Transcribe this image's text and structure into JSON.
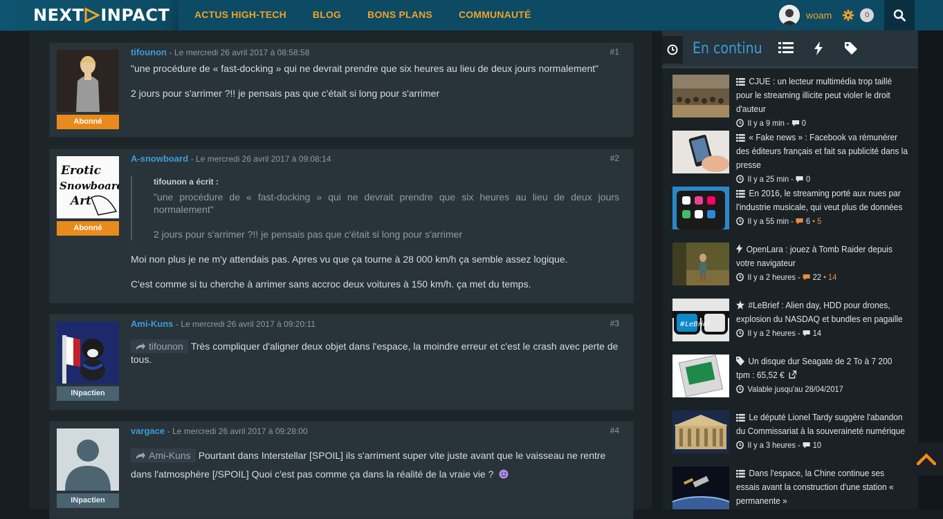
{
  "header": {
    "logo_text_left": "NEXT",
    "logo_text_right": "INPACT",
    "nav": [
      "ACTUS HIGH-TECH",
      "BLOG",
      "BONS PLANS",
      "COMMUNAUTÉ"
    ],
    "username": "woam",
    "notif_count": "0"
  },
  "comments": [
    {
      "author": "tifounon",
      "date": "- Le mercredi 26 avril 2017 à 08:58:58",
      "num": "#1",
      "badge": "Abonné",
      "paragraphs": [
        "\"une procédure de « fast-docking » qui ne devrait prendre que six heures au lieu de deux jours normalement\"",
        "2 jours pour s'arrimer ?!! je pensais pas que c'était si long pour s'arrimer"
      ]
    },
    {
      "author": "A-snowboard",
      "date": "- Le mercredi 26 avril 2017 à 09:08:14",
      "num": "#2",
      "badge": "Abonné",
      "quote_author": "tifounon a écrit :",
      "quote": [
        "\"une procédure de « fast-docking » qui ne devrait prendre que six heures au lieu de deux jours normalement\"",
        "2 jours pour s'arrimer ?!! je pensais pas que c'était si long pour s'arrimer"
      ],
      "paragraphs": [
        "Moi non plus je ne m'y attendais pas. Apres vu que ça tourne à 28 000 km/h ça semble assez logique.",
        "C'est comme si tu cherche à arrimer sans accroc deux voitures à 150 km/h. ça met du temps."
      ]
    },
    {
      "author": "Ami-Kuns",
      "date": "- Le mercredi 26 avril 2017 à 09:20:11",
      "num": "#3",
      "badge": "INpactien",
      "reply_to": "tifounon",
      "text": "Très compliquer d'aligner deux objet dans l'espace, la moindre erreur et c'est le crash avec perte de tous."
    },
    {
      "author": "vargace",
      "date": "- Le mercredi 26 avril 2017 à 09:28:00",
      "num": "#4",
      "badge": "INpactien",
      "reply_to": "Ami-Kuns",
      "text": "Pourtant dans Interstellar  [SPOIL] ils s'arriment super vite juste avant que le vaisseau ne rentre dans l'atmosphère [/SPOIL] Quoi c'est pas comme ça dans la réalité de la vraie vie ?"
    }
  ],
  "sidebar": {
    "title": "En continu",
    "news": [
      {
        "icon": "list-icon",
        "title": "CJUE : un lecteur multimédia trop taillé pour le streaming illicite peut violer le droit d'auteur",
        "time": "Il y a 9 min",
        "comments": "0",
        "hot": ""
      },
      {
        "icon": "list-icon",
        "title": "« Fake news » : Facebook va rémunérer des éditeurs français et fait sa publicité dans la presse",
        "time": "Il y a 25 min",
        "comments": "0",
        "hot": ""
      },
      {
        "icon": "list-icon",
        "title": "En 2016, le streaming porté aux nues par l'industrie musicale, qui veut plus de données",
        "time": "Il y a 55 min",
        "comments": "6",
        "hot": "• 5"
      },
      {
        "icon": "bolt-icon",
        "title": "OpenLara : jouez à Tomb Raider depuis votre navigateur",
        "time": "Il y a 2 heures",
        "comments": "22",
        "hot": "• 14"
      },
      {
        "icon": "star-icon",
        "title": "#LeBrief : Alien day, HDD pour drones, explosion du NASDAQ et bundles en pagaille",
        "time": "Il y a 2 heures",
        "comments": "14",
        "hot": ""
      },
      {
        "icon": "tag-icon",
        "title": "Un disque dur Seagate de 2 To à 7 200 tpm : 65,52 €",
        "time": "Valable jusqu'au 28/04/2017",
        "comments": "",
        "hot": ""
      },
      {
        "icon": "list-icon",
        "title": "Le député Lionel Tardy suggère l'abandon du Commissariat à la souveraineté numérique",
        "time": "Il y a 3 heures",
        "comments": "10",
        "hot": ""
      },
      {
        "icon": "list-icon",
        "title": "Dans l'espace, la Chine continue ses essais avant la construction d'une station « permanente »",
        "time": "",
        "comments": "",
        "hot": ""
      }
    ]
  }
}
